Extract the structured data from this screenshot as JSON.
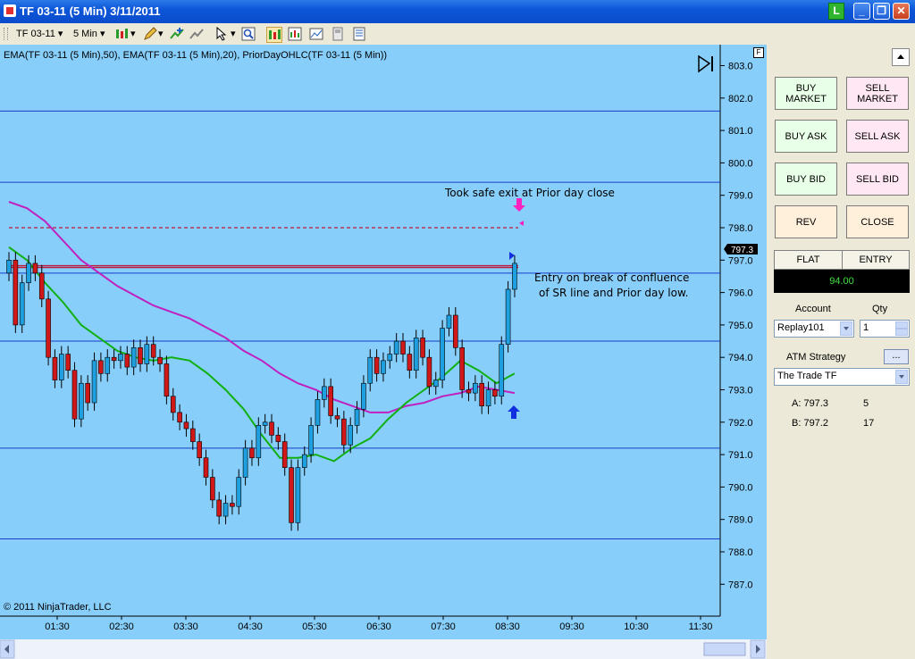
{
  "window": {
    "title": "TF 03-11 (5 Min)  3/11/2011",
    "badge": "L"
  },
  "toolbar": {
    "instrument": "TF 03-11",
    "interval": "5 Min"
  },
  "chart": {
    "indicator_label": "EMA(TF 03-11 (5 Min),50), EMA(TF 03-11 (5 Min),20), PriorDayOHLC(TF 03-11 (5 Min))",
    "f_marker": "F",
    "copyright": "© 2011 NinjaTrader, LLC",
    "price_ticks": [
      "803.0",
      "802.0",
      "801.0",
      "800.0",
      "799.0",
      "798.0",
      "797.0",
      "796.0",
      "795.0",
      "794.0",
      "793.0",
      "792.0",
      "791.0",
      "790.0",
      "789.0",
      "788.0",
      "787.0"
    ],
    "time_ticks": [
      "01:30",
      "02:30",
      "03:30",
      "04:30",
      "05:30",
      "06:30",
      "07:30",
      "08:30",
      "09:30",
      "10:30",
      "11:30"
    ],
    "last_price": "797.3",
    "annotation_exit": "Took safe exit at Prior day close",
    "annotation_entry_1": "Entry on break of confluence",
    "annotation_entry_2": "of SR line and Prior day low.",
    "colors": {
      "background": "#87cefa",
      "up": "#1ea0e0",
      "down": "#d01818",
      "ema50": "#c020c0",
      "ema20": "#10b010",
      "sr_line": "#1a3cc8"
    }
  },
  "chart_data": {
    "type": "candlestick",
    "title": "TF 03-11 (5 Min)",
    "ylim": [
      787,
      803
    ],
    "horizontal_levels": [
      801.6,
      799.4,
      796.6,
      794.5,
      791.2,
      788.4
    ],
    "prior_day_close": 798.0,
    "prior_day_low": 796.8,
    "series": [
      {
        "name": "EMA(TF 03-11 (5 Min),50)",
        "values": [
          798.8,
          798.6,
          798.2,
          797.6,
          797.0,
          796.6,
          796.2,
          795.9,
          795.6,
          795.4,
          795.2,
          794.9,
          794.6,
          794.2,
          793.9,
          793.5,
          793.2,
          793.0,
          792.7,
          792.5,
          792.3,
          792.3,
          792.5,
          792.6,
          792.8,
          792.9,
          793.1,
          793.0,
          792.9
        ]
      },
      {
        "name": "EMA(TF 03-11 (5 Min),20)",
        "values": [
          797.4,
          797.0,
          796.3,
          795.7,
          795.0,
          794.6,
          794.2,
          794.0,
          793.9,
          794.0,
          793.9,
          793.5,
          793.0,
          792.4,
          791.6,
          790.9,
          790.9,
          791.0,
          790.8,
          791.2,
          791.5,
          792.1,
          792.6,
          793.0,
          793.4,
          793.9,
          793.6,
          793.2,
          793.5
        ]
      }
    ],
    "annotations": [
      "Took safe exit at Prior day close",
      "Entry on break of confluence of SR line and Prior day low."
    ]
  },
  "panel": {
    "buy_market": "BUY MARKET",
    "sell_market": "SELL MARKET",
    "buy_ask": "BUY ASK",
    "sell_ask": "SELL ASK",
    "buy_bid": "BUY BID",
    "sell_bid": "SELL BID",
    "rev": "REV",
    "close": "CLOSE",
    "position_label": "FLAT",
    "entry_label": "ENTRY",
    "pnl": "94.00",
    "account_label": "Account",
    "qty_label": "Qty",
    "account": "Replay101",
    "qty": "1",
    "atm_label": "ATM Strategy",
    "atm_btn": "...",
    "atm_value": "The Trade TF",
    "ask_label": "A: 797.3",
    "ask_size": "5",
    "bid_label": "B: 797.2",
    "bid_size": "17"
  }
}
